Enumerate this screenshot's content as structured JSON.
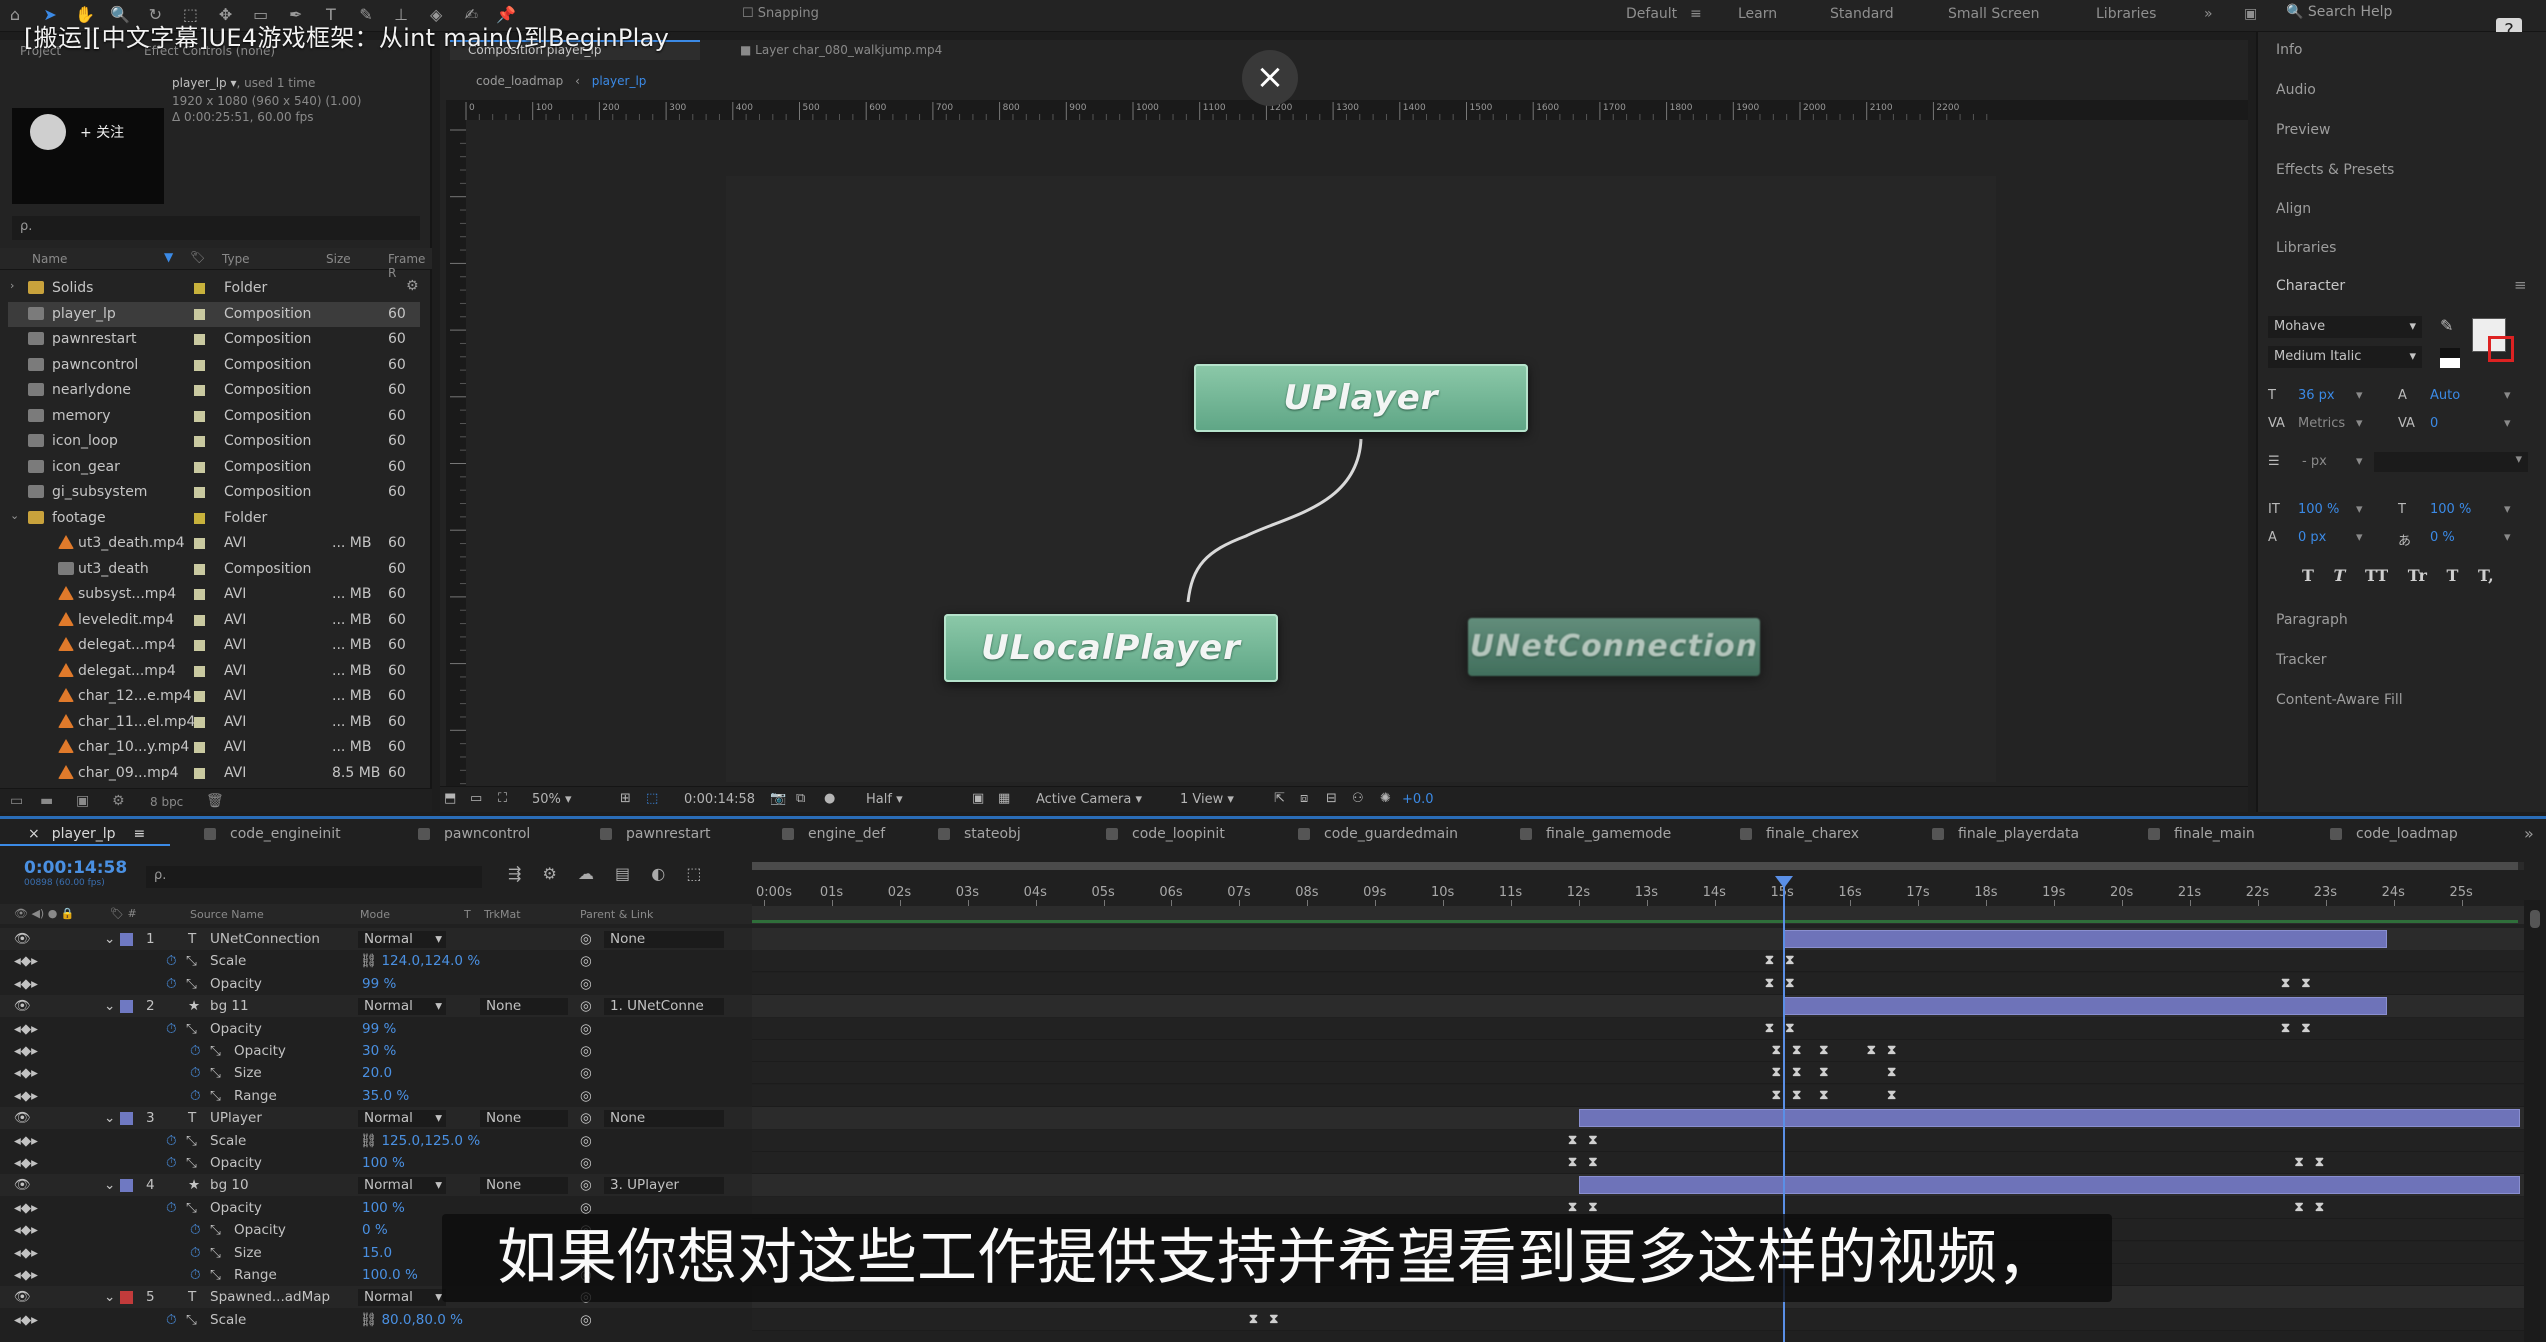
{
  "video": {
    "title": "[搬运][中文字幕]UE4游戏框架：从int main()到BeginPlay",
    "follow_label": "+ 关注",
    "close_icon": "×",
    "subtitle": "如果你想对这些工作提供支持并希望看到更多这样的视频，"
  },
  "menubar": {
    "snapping": "Snapping",
    "workspaces": [
      "Default",
      "Learn",
      "Standard",
      "Small Screen",
      "Libraries"
    ],
    "search_help": "Search Help"
  },
  "project": {
    "tabs": {
      "project": "Project",
      "effect_controls": "Effect Controls (none)"
    },
    "selected": {
      "name": "player_lp ▾",
      "used": ", used 1 time",
      "dims": "1920 x 1080 (960 x 540) (1.00)",
      "duration": "Δ 0:00:25:51, 60.00 fps"
    },
    "search_placeholder": "ρ.",
    "columns": {
      "name": "Name",
      "type": "Type",
      "size": "Size",
      "frame": "Frame R"
    },
    "rows": [
      {
        "name": "Solids",
        "type": "Folder",
        "size": "",
        "frame": "",
        "kind": "folder",
        "label": "#c8b23c"
      },
      {
        "name": "player_lp",
        "type": "Composition",
        "size": "",
        "frame": "60",
        "kind": "comp",
        "label": "#c9c9a0"
      },
      {
        "name": "pawnrestart",
        "type": "Composition",
        "size": "",
        "frame": "60",
        "kind": "comp",
        "label": "#c9c9a0"
      },
      {
        "name": "pawncontrol",
        "type": "Composition",
        "size": "",
        "frame": "60",
        "kind": "comp",
        "label": "#c9c9a0"
      },
      {
        "name": "nearlydone",
        "type": "Composition",
        "size": "",
        "frame": "60",
        "kind": "comp",
        "label": "#c9c9a0"
      },
      {
        "name": "memory",
        "type": "Composition",
        "size": "",
        "frame": "60",
        "kind": "comp",
        "label": "#c9c9a0"
      },
      {
        "name": "icon_loop",
        "type": "Composition",
        "size": "",
        "frame": "60",
        "kind": "comp",
        "label": "#c9c9a0"
      },
      {
        "name": "icon_gear",
        "type": "Composition",
        "size": "",
        "frame": "60",
        "kind": "comp",
        "label": "#c9c9a0"
      },
      {
        "name": "gi_subsystem",
        "type": "Composition",
        "size": "",
        "frame": "60",
        "kind": "comp",
        "label": "#c9c9a0"
      },
      {
        "name": "footage",
        "type": "Folder",
        "size": "",
        "frame": "",
        "kind": "folder",
        "label": "#c8b23c"
      },
      {
        "name": "ut3_death.mp4",
        "type": "AVI",
        "size": "... MB",
        "frame": "60",
        "kind": "avi",
        "label": "#c9c9a0"
      },
      {
        "name": "ut3_death",
        "type": "Composition",
        "size": "",
        "frame": "60",
        "kind": "comp",
        "label": "#c9c9a0"
      },
      {
        "name": "subsyst...mp4",
        "type": "AVI",
        "size": "... MB",
        "frame": "60",
        "kind": "avi",
        "label": "#c9c9a0"
      },
      {
        "name": "leveledit.mp4",
        "type": "AVI",
        "size": "... MB",
        "frame": "60",
        "kind": "avi",
        "label": "#c9c9a0"
      },
      {
        "name": "delegat...mp4",
        "type": "AVI",
        "size": "... MB",
        "frame": "60",
        "kind": "avi",
        "label": "#c9c9a0"
      },
      {
        "name": "delegat...mp4",
        "type": "AVI",
        "size": "... MB",
        "frame": "60",
        "kind": "avi",
        "label": "#c9c9a0"
      },
      {
        "name": "char_12...e.mp4",
        "type": "AVI",
        "size": "... MB",
        "frame": "60",
        "kind": "avi",
        "label": "#c9c9a0"
      },
      {
        "name": "char_11...el.mp4",
        "type": "AVI",
        "size": "... MB",
        "frame": "60",
        "kind": "avi",
        "label": "#c9c9a0"
      },
      {
        "name": "char_10...y.mp4",
        "type": "AVI",
        "size": "... MB",
        "frame": "60",
        "kind": "avi",
        "label": "#c9c9a0"
      },
      {
        "name": "char_09...mp4",
        "type": "AVI",
        "size": "8.5 MB",
        "frame": "60",
        "kind": "avi",
        "label": "#c9c9a0"
      }
    ],
    "footer_bpc": "8 bpc"
  },
  "comp": {
    "tab_title": "Composition player_lp",
    "layer_tab": "Layer char_080_walkjump.mp4",
    "breadcrumbs": [
      "code_loadmap",
      "player_lp"
    ],
    "ruler_labels": [
      "0",
      "100",
      "200",
      "300",
      "400",
      "500",
      "600",
      "700",
      "800",
      "900",
      "1000",
      "1100",
      "1200",
      "1300",
      "1400",
      "1500",
      "1600",
      "1700",
      "1800",
      "1900",
      "2000",
      "2100",
      "2200"
    ],
    "nodes": {
      "uplayer": "UPlayer",
      "ulocalplayer": "ULocalPlayer",
      "unetconnection": "UNetConnection"
    },
    "footer": {
      "zoom": "50%",
      "timecode": "0:00:14:58",
      "resolution": "Half",
      "camera": "Active Camera",
      "views": "1 View",
      "exposure": "+0.0"
    }
  },
  "right_panel": {
    "sections": [
      "Info",
      "Audio",
      "Preview",
      "Effects & Presets",
      "Align",
      "Libraries",
      "Character"
    ],
    "font": "Mohave",
    "style": "Medium Italic",
    "size": "36 px",
    "leading": "Auto",
    "kerning": "Metrics",
    "tracking": "0",
    "stroke": "- px",
    "vscale": "100 %",
    "hscale": "100 %",
    "baseline": "0 px",
    "tsume": "0 %",
    "styles": [
      "T",
      "T",
      "TT",
      "Tr",
      "T",
      "T,"
    ],
    "lower_sections": [
      "Paragraph",
      "Tracker",
      "Content-Aware Fill"
    ]
  },
  "timeline": {
    "tabs": [
      "player_lp",
      "code_engineinit",
      "pawncontrol",
      "pawnrestart",
      "engine_def",
      "stateobj",
      "code_loopinit",
      "code_guardedmain",
      "finale_gamemode",
      "finale_charex",
      "finale_playerdata",
      "finale_main",
      "code_loadmap"
    ],
    "timecode": "0:00:14:58",
    "timecode_sub": "00898 (60.00 fps)",
    "search_placeholder": "ρ.",
    "columns": {
      "source": "Source Name",
      "mode": "Mode",
      "t": "T",
      "trkmat": "TrkMat",
      "parent": "Parent & Link"
    },
    "ticks": [
      "0:00s",
      "01s",
      "02s",
      "03s",
      "04s",
      "05s",
      "06s",
      "07s",
      "08s",
      "09s",
      "10s",
      "11s",
      "12s",
      "13s",
      "14s",
      "15s",
      "16s",
      "17s",
      "18s",
      "19s",
      "20s",
      "21s",
      "22s",
      "23s",
      "24s",
      "25s"
    ],
    "layers": [
      {
        "num": "1",
        "type": "T",
        "name": "UNetConnection",
        "mode": "Normal",
        "trkmat": "",
        "parent": "None",
        "props": [
          {
            "name": "Scale",
            "value": "124.0,124.0 %"
          },
          {
            "name": "Opacity",
            "value": "99 %"
          }
        ]
      },
      {
        "num": "2",
        "type": "★",
        "name": "bg 11",
        "mode": "Normal",
        "trkmat": "None",
        "parent": "1. UNetConne",
        "props": [
          {
            "name": "Opacity",
            "value": "99 %"
          },
          {
            "name": "Opacity",
            "value": "30 %",
            "sub": true
          },
          {
            "name": "Size",
            "value": "20.0",
            "sub": true
          },
          {
            "name": "Range",
            "value": "35.0 %",
            "sub": true
          }
        ]
      },
      {
        "num": "3",
        "type": "T",
        "name": "UPlayer",
        "mode": "Normal",
        "trkmat": "None",
        "parent": "None",
        "props": [
          {
            "name": "Scale",
            "value": "125.0,125.0 %"
          },
          {
            "name": "Opacity",
            "value": "100 %"
          }
        ]
      },
      {
        "num": "4",
        "type": "★",
        "name": "bg 10",
        "mode": "Normal",
        "trkmat": "None",
        "parent": "3. UPlayer",
        "props": [
          {
            "name": "Opacity",
            "value": "100 %"
          },
          {
            "name": "Opacity",
            "value": "0 %",
            "sub": true
          },
          {
            "name": "Size",
            "value": "15.0",
            "sub": true
          },
          {
            "name": "Range",
            "value": "100.0 %",
            "sub": true
          }
        ]
      },
      {
        "num": "5",
        "type": "T",
        "name": "Spawned...adMap",
        "mode": "Normal",
        "trkmat": "",
        "parent": "",
        "props": [
          {
            "name": "Scale",
            "value": "80.0,80.0 %"
          }
        ]
      }
    ],
    "current_time_s": 15.0
  }
}
